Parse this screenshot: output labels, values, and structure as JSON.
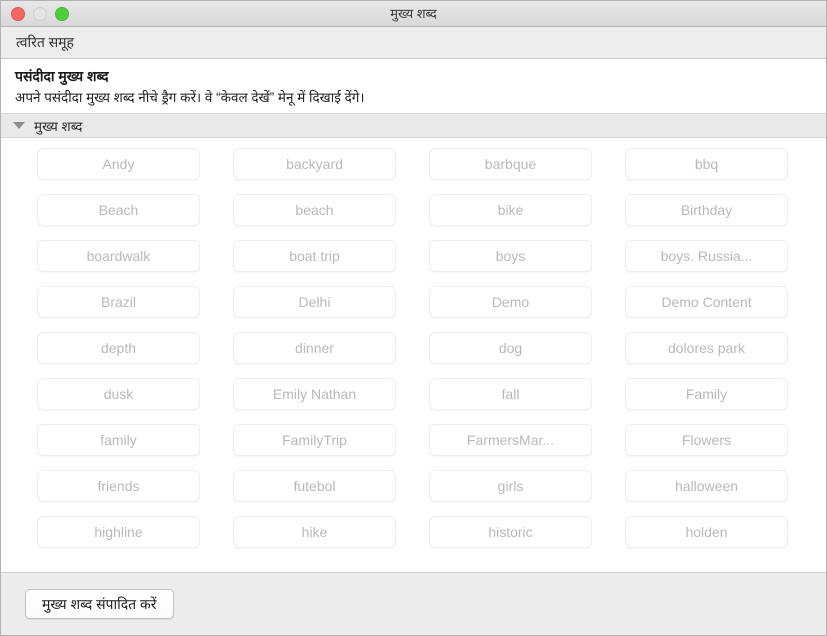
{
  "window": {
    "title": "मुख्य शब्द",
    "traffic_lights": {
      "close_color": "#f0685f",
      "minimize_color": "#e4e4e4",
      "maximize_color": "#4fcc3c"
    }
  },
  "toolbar": {
    "quick_group_label": "त्वरित समूह"
  },
  "intro": {
    "heading": "पसंदीदा मुख्य शब्द",
    "description": "अपने पसंदीदा मुख्य शब्द नीचे ड्रैग करें। वे “केवल देखें” मेनू में दिखाई देंगे।"
  },
  "section": {
    "title": "मुख्य शब्द",
    "expanded": true,
    "disclosure_icon": "triangle-down-icon"
  },
  "tags": [
    "Andy",
    "backyard",
    "barbque",
    "bbq",
    "Beach",
    "beach",
    "bike",
    "Birthday",
    "boardwalk",
    "boat trip",
    "boys",
    "boys. Russia...",
    "Brazil",
    "Delhi",
    "Demo",
    "Demo Content",
    "depth",
    "dinner",
    "dog",
    "dolores park",
    "dusk",
    "Emily Nathan",
    "fall",
    "Family",
    "family",
    "FamilyTrip",
    "FarmersMar...",
    "Flowers",
    "friends",
    "futebol",
    "girls",
    "halloween",
    "highline",
    "hike",
    "historic",
    "holden"
  ],
  "footer": {
    "edit_keywords_label": "मुख्य शब्द संपादित करें"
  },
  "colors": {
    "tag_text": "#b9b9b9",
    "tag_border": "#ededed",
    "titlebar_bg": "#e0e0e0",
    "section_bg": "#e9e9e9",
    "footer_bg": "#ececec"
  }
}
